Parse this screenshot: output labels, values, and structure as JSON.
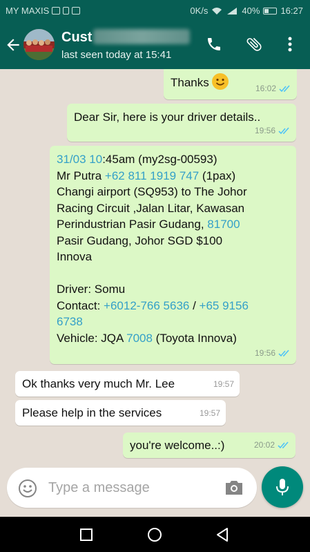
{
  "status_bar": {
    "carrier": "MY MAXIS",
    "data_speed": "0K/s",
    "battery": "40%",
    "battery_level": 0.4,
    "time": "16:27"
  },
  "header": {
    "contact_name": "Cust",
    "last_seen": "last seen today at 15:41",
    "icons": [
      "back-arrow-icon",
      "phone-icon",
      "paperclip-icon",
      "more-vert-icon"
    ]
  },
  "messages": [
    {
      "direction": "out",
      "text": "Thanks",
      "has_emoji": true,
      "time": "16:02",
      "ticks": "read"
    },
    {
      "direction": "out",
      "text": "Dear Sir, here is your driver details..",
      "time": "19:56",
      "ticks": "read"
    },
    {
      "direction": "out",
      "time": "19:56",
      "ticks": "read",
      "lines": {
        "l1_date": "31/03",
        "l1_hour": "10",
        "l1_rest": ":45am  (my2sg-00593)",
        "l2_name": "Mr Putra  ",
        "l2_phone": "+62 811 1919 747",
        "l2_rest": " (1pax)",
        "l3": "Changi airport (SQ953) to The Johor",
        "l4": "Racing Circuit ,Jalan Litar, Kawasan",
        "l5_text": "Perindustrian Pasir Gudang, ",
        "l5_postcode": "81700",
        "l6": "Pasir Gudang, Johor  SGD $100",
        "l7": "Innova",
        "l8": "Driver: Somu",
        "l9_label": "Contact: ",
        "l9_phone1": "+6012-766 5636",
        "l9_sep": " / ",
        "l9_phone2a": "+65 9156",
        "l10_phone2b": "6738",
        "l11_label": "Vehicle: JQA ",
        "l11_num": "7008",
        "l11_rest": " (Toyota Innova)"
      }
    },
    {
      "direction": "in",
      "text": "Ok thanks very much Mr. Lee",
      "time": "19:57"
    },
    {
      "direction": "in",
      "text": "Please help in the services",
      "time": "19:57"
    },
    {
      "direction": "out",
      "text": "you're welcome..:)",
      "time": "20:02",
      "ticks": "read"
    }
  ],
  "composer": {
    "placeholder": "Type a message",
    "icons": [
      "emoji-icon",
      "camera-icon",
      "microphone-icon"
    ]
  },
  "navbar": {
    "icons": [
      "recents-square-icon",
      "home-circle-icon",
      "back-triangle-icon"
    ]
  },
  "colors": {
    "header": "#075e54",
    "outgoing_bubble": "#dcf8c6",
    "incoming_bubble": "#ffffff",
    "chat_background": "#e5ddd5",
    "link": "#34a0c8",
    "read_ticks": "#4fc3f7",
    "mic_button": "#00897b"
  }
}
